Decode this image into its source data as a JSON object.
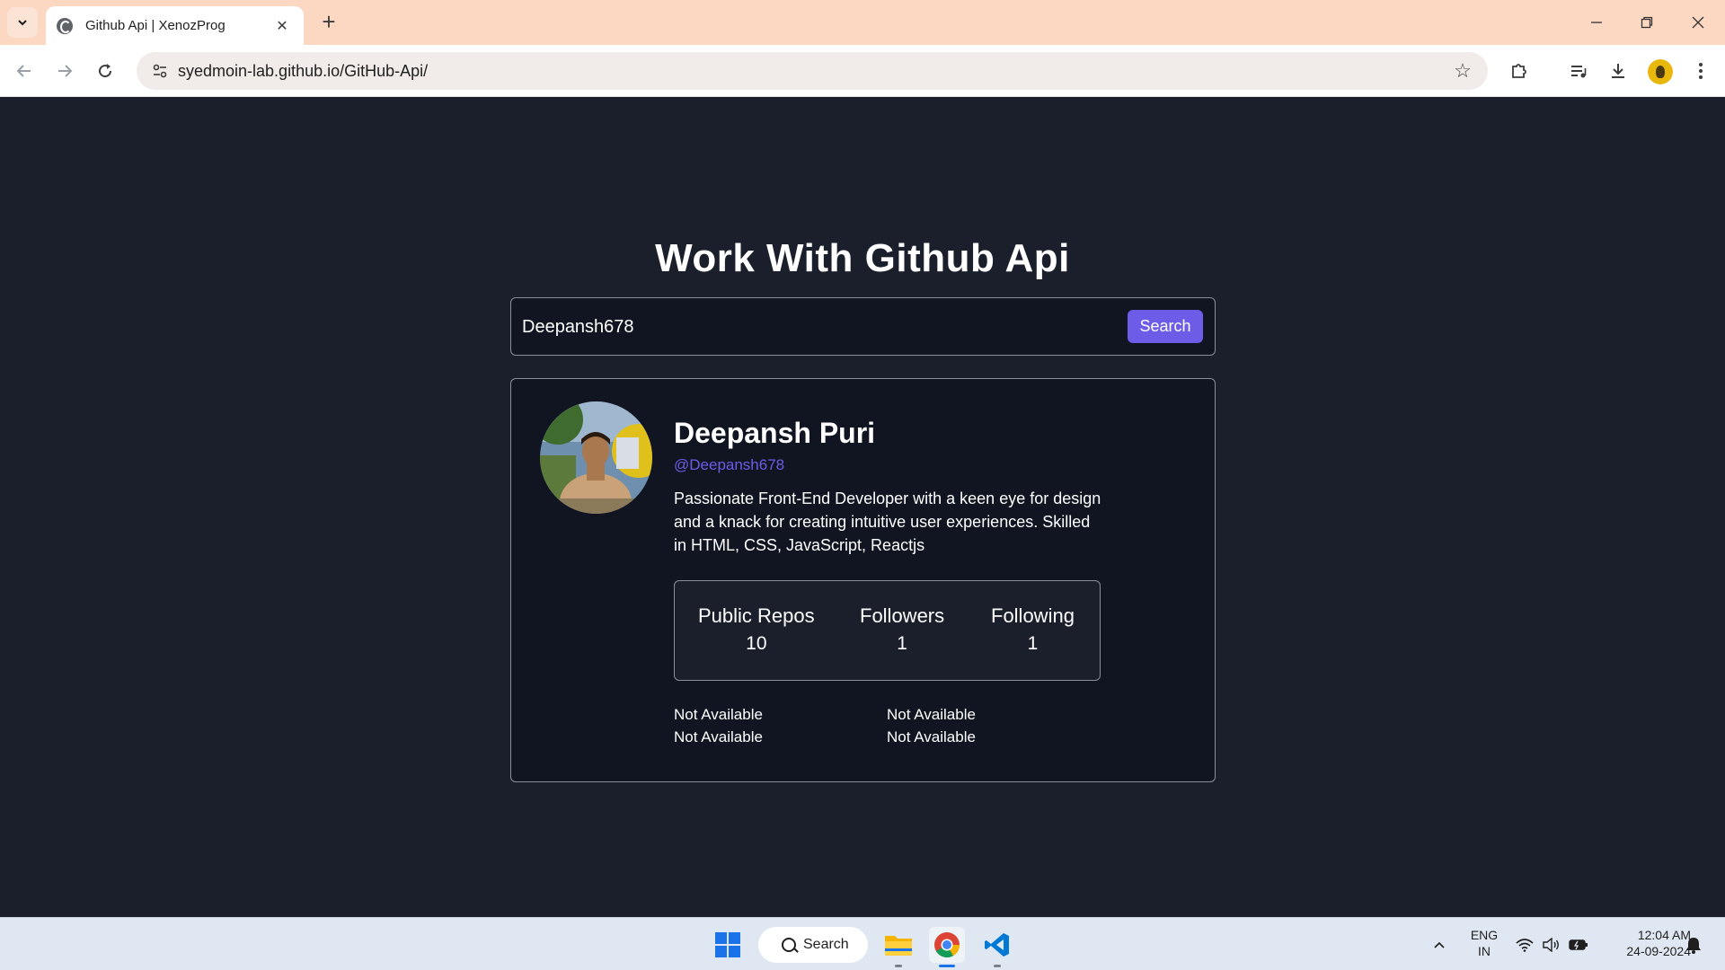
{
  "browser": {
    "tab_title": "Github Api | XenozProg",
    "url": "syedmoin-lab.github.io/GitHub-Api/",
    "new_tab_symbol": "+",
    "tab_close_symbol": "✕"
  },
  "page": {
    "heading": "Work With Github Api",
    "search": {
      "value": "Deepansh678",
      "button_label": "Search"
    },
    "profile": {
      "name": "Deepansh Puri",
      "handle": "@Deepansh678",
      "bio": "Passionate Front-End Developer with a keen eye for design and a knack for creating intuitive user experiences. Skilled in HTML, CSS, JavaScript, Reactjs",
      "stats": [
        {
          "label": "Public Repos",
          "value": "10"
        },
        {
          "label": "Followers",
          "value": "1"
        },
        {
          "label": "Following",
          "value": "1"
        }
      ],
      "meta": {
        "location": "Not Available",
        "website": "Not Available",
        "twitter": "Not Available",
        "company": "Not Available"
      }
    },
    "colors": {
      "background": "#1b1f2b",
      "card": "#111521",
      "accent": "#6c5ce7"
    }
  },
  "taskbar": {
    "search_label": "Search",
    "language_line1": "ENG",
    "language_line2": "IN",
    "time": "12:04 AM",
    "date": "24-09-2024",
    "apps": [
      "windows-start-icon",
      "file-explorer-icon",
      "chrome-icon",
      "vscode-icon"
    ]
  }
}
